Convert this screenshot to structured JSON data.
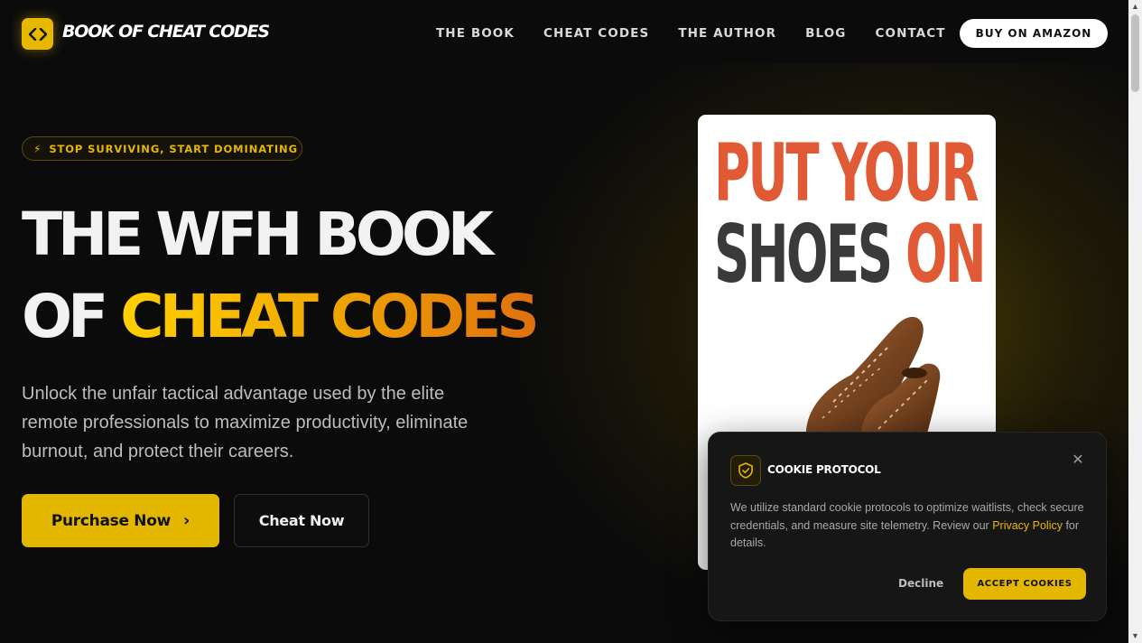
{
  "header": {
    "logo_text": "BOOK OF CHEAT CODES",
    "nav": [
      "THE BOOK",
      "CHEAT CODES",
      "THE AUTHOR",
      "BLOG",
      "CONTACT"
    ],
    "buy_label": "BUY ON AMAZON"
  },
  "hero": {
    "tagline": "STOP SURVIVING, START DOMINATING",
    "headline_line1": "THE WFH BOOK",
    "headline_line2_plain": "OF ",
    "headline_line2_accent": "CHEAT CODES",
    "subtitle": "Unlock the unfair tactical advantage used by the elite remote professionals to maximize productivity, eliminate burnout, and protect their careers.",
    "primary_button": "Purchase Now",
    "secondary_button": "Cheat Now"
  },
  "book": {
    "title_line1": "PUT YOUR",
    "title_line2_a": "SHOES ",
    "title_line2_b": "ON"
  },
  "cookie": {
    "title": "COOKIE PROTOCOL",
    "text_before": "We utilize standard cookie protocols to optimize waitlists, check secure credentials, and measure site telemetry. Review our ",
    "link_text": "Privacy Policy",
    "text_after": " for details.",
    "decline_label": "Decline",
    "accept_label": "ACCEPT COOKIES"
  },
  "colors": {
    "accent": "#e3b600",
    "background": "#0b0b0b",
    "book_red": "#e05a35"
  }
}
